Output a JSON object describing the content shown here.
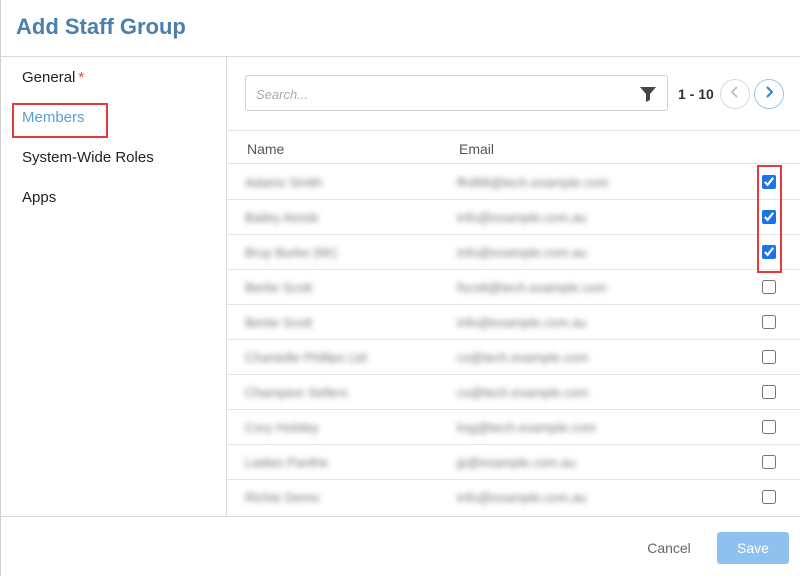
{
  "dialog": {
    "title": "Add Staff Group"
  },
  "sidebar": {
    "items": [
      {
        "label": "General",
        "required_mark": "*"
      },
      {
        "label": "Members"
      },
      {
        "label": "System-Wide Roles"
      },
      {
        "label": "Apps"
      }
    ],
    "active": "Members"
  },
  "search": {
    "placeholder": "Search...",
    "value": ""
  },
  "pager": {
    "range": "1 - 10"
  },
  "table": {
    "headers": {
      "name": "Name",
      "email": "Email"
    },
    "rows": [
      {
        "name": "Adams Smith",
        "email": "ffrd99@tech.example.com",
        "checked": true
      },
      {
        "name": "Bailey Ainsle",
        "email": "info@example.com.au",
        "checked": true
      },
      {
        "name": "Bruy Burke (Mr)",
        "email": "info@example.com.au",
        "checked": true
      },
      {
        "name": "Bertie Scott",
        "email": "fscott@tech.example.com",
        "checked": false
      },
      {
        "name": "Bertie Scott",
        "email": "info@example.com.au",
        "checked": false
      },
      {
        "name": "Chantelle Phillips Ltd",
        "email": "cs@tech.example.com",
        "checked": false
      },
      {
        "name": "Champion Sellers",
        "email": "cs@tech.example.com",
        "checked": false
      },
      {
        "name": "Cory Holsley",
        "email": "ksg@tech.example.com",
        "checked": false
      },
      {
        "name": "Ladies Panthe",
        "email": "jp@example.com.au",
        "checked": false
      },
      {
        "name": "Richie Demo",
        "email": "info@example.com.au",
        "checked": false
      }
    ]
  },
  "footer": {
    "cancel_label": "Cancel",
    "save_label": "Save"
  },
  "colors": {
    "accent": "#4a7fae",
    "active_nav": "#5a9fd6",
    "save_button": "#8ec1ee",
    "highlight": "#e33b3b"
  },
  "icons": {
    "filter": "funnel-icon",
    "prev": "chevron-left-icon",
    "next": "chevron-right-icon"
  }
}
